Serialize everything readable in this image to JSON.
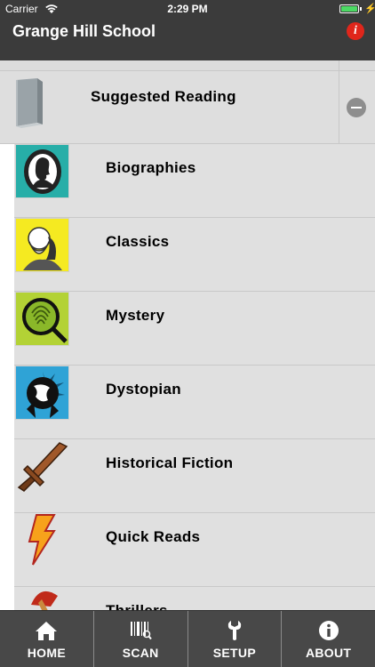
{
  "status_bar": {
    "carrier": "Carrier",
    "time": "2:29 PM",
    "battery_level": 1.0,
    "battery_color": "#4cd964"
  },
  "header": {
    "title": "Grange Hill School",
    "info_icon": "info-icon",
    "info_icon_color": "#e0261b"
  },
  "section": {
    "label": "Suggested Reading",
    "icon": "book-icon",
    "toggle_icon": "collapse-icon"
  },
  "categories": [
    {
      "label": "Biographies",
      "icon": "silhouette-cameo-icon"
    },
    {
      "label": "Classics",
      "icon": "bearded-author-icon"
    },
    {
      "label": "Mystery",
      "icon": "magnifier-fingerprint-icon"
    },
    {
      "label": "Dystopian",
      "icon": "ruined-globe-icon"
    },
    {
      "label": "Historical Fiction",
      "icon": "wooden-sword-icon"
    },
    {
      "label": "Quick Reads",
      "icon": "lightning-bolt-icon"
    },
    {
      "label": "Thrillers",
      "icon": "axe-icon"
    }
  ],
  "tabs": [
    {
      "label": "HOME",
      "icon": "home-icon"
    },
    {
      "label": "SCAN",
      "icon": "barcode-icon"
    },
    {
      "label": "SETUP",
      "icon": "wrench-icon"
    },
    {
      "label": "ABOUT",
      "icon": "info-icon"
    }
  ],
  "colors": {
    "header_bg": "#3b3b3b",
    "row_bg": "#e0e0e0",
    "tabbar_bg": "#484848"
  }
}
